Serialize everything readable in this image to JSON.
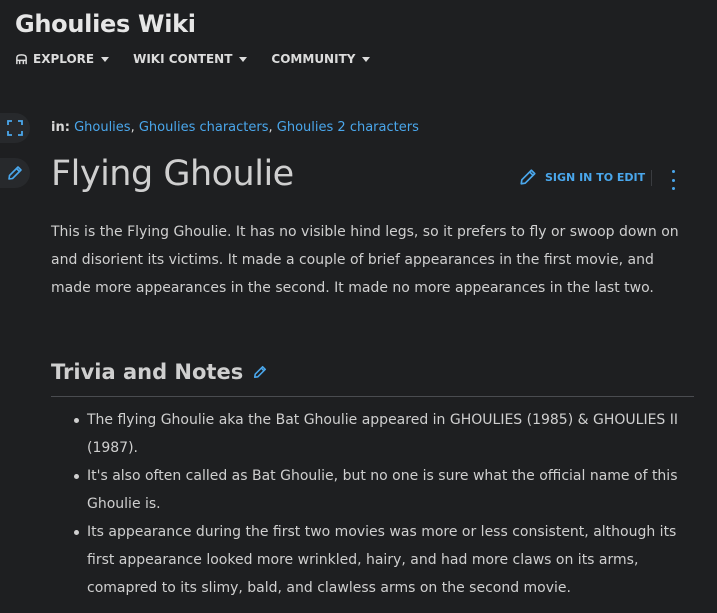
{
  "header": {
    "wiki_title": "Ghoulies Wiki",
    "nav": [
      {
        "label": "EXPLORE",
        "icon": "explore-icon"
      },
      {
        "label": "WIKI CONTENT"
      },
      {
        "label": "COMMUNITY"
      }
    ]
  },
  "breadcrumbs": {
    "prefix": "in:",
    "categories": [
      "Ghoulies",
      "Ghoulies characters",
      "Ghoulies 2 characters"
    ],
    "sep1": ", ",
    "sep2": ", "
  },
  "article": {
    "title": "Flying Ghoulie",
    "sign_in_label": "SIGN IN TO EDIT",
    "intro": "This is the Flying Ghoulie. It has no visible hind legs, so it prefers to fly or swoop down on and disorient its victims. It made a couple of brief appearances in the first movie, and made more appearances in the second. It made no more appearances in the last two.",
    "section_title": "Trivia and Notes",
    "trivia": [
      "The flying Ghoulie aka the Bat Ghoulie appeared in GHOULIES (1985) & GHOULIES II (1987).",
      "It's also often called as Bat Ghoulie, but no one is sure what the official name of this Ghoulie is.",
      "Its appearance during the first two movies was more or less consistent, although its first appearance looked more wrinkled, hairy, and had more claws on its arms, comapred to its slimy, bald, and clawless arms on the second movie."
    ]
  },
  "colors": {
    "background": "#1e1f21",
    "link": "#4aa7ec",
    "text": "#cfcfcf"
  }
}
